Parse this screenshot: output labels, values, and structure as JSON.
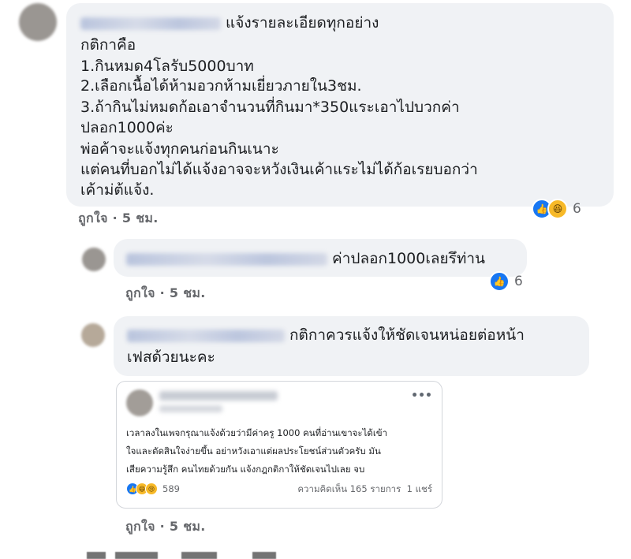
{
  "comment1": {
    "lines": [
      "แจ้งรายละเอียดทุกอย่าง",
      "กติกาคือ",
      "1.กินหมด4โลรับ5000บาท",
      "2.เลือกเนื้อได้ห้ามอวกห้ามเยี่ยวภายใน3ชม.",
      "3.ถ้ากินไม่หมดก้อเอาจำนวนที่กินมา*350แระเอาไปบวกค่า",
      "ปลอก1000ค่ะ",
      "พ่อค้าจะแจ้งทุกคนก่อนกินเนาะ",
      "แต่คนที่บอกไม่ได้แจ้งอาจจะหวังเงินเค้าแระไม่ได้ก้อเรยบอกว่า",
      "เค้าม่ต้แจ้ง."
    ],
    "like_label": "ถูกใจ",
    "time": "5 ชม.",
    "reaction_count": "6"
  },
  "reply1": {
    "text": "ค่าปลอก1000เลยรึท่าน",
    "like_label": "ถูกใจ",
    "time": "5 ชม.",
    "reaction_count": "6"
  },
  "reply2": {
    "line1": "กติกาควรแจ้งให้ชัดเจนหน่อยต่อหน้า",
    "line2": "เฟสด้วยนะคะ",
    "like_label": "ถูกใจ",
    "time": "5 ชม.",
    "shared_card": {
      "menu": "•••",
      "lines": [
        "เวลาลงในเพจกรุณาแจ้งด้วยว่ามีค่าครู 1000 คนที่อ่านเขาจะได้เข้า",
        "ใจและตัดสินใจง่ายขึ้น อย่าหวังเอาแต่ผลประโยชน์ส่วนตัวครับ มัน",
        "เสียความรู้สึก คนไทยด้วยกัน แจ้งกฎกติกาให้ชัดเจนไปเลย จบ"
      ],
      "reaction_count": "589",
      "comments_count": "ความคิดเห็น 165 รายการ",
      "shares": "1 แชร์"
    }
  },
  "icons": {
    "like": "thumbs-up",
    "haha": "laughing-face",
    "sad": "sad-face"
  },
  "colors": {
    "bubble": "#f0f2f5",
    "like_blue": "#1877f2",
    "muted": "#65676b"
  }
}
